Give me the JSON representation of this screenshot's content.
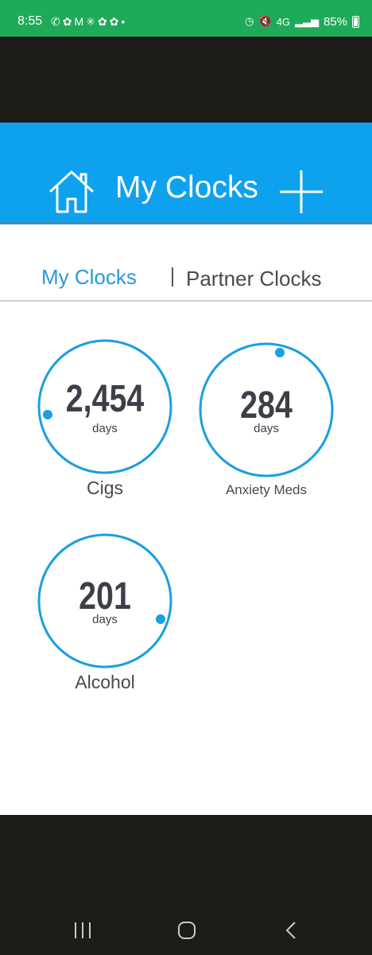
{
  "status_bar": {
    "time": "8:55",
    "left_icons": [
      "phone-icon",
      "app-icon",
      "mail-icon",
      "walmart-icon",
      "app-icon",
      "app-icon",
      "dot-icon"
    ],
    "network": "4G",
    "battery_percent": "85%",
    "background": "#1faa59"
  },
  "header": {
    "title": "My Clocks",
    "background": "#0ea1ee",
    "home_icon": "home-icon",
    "add_icon": "plus-icon"
  },
  "tabs": {
    "mine": "My Clocks",
    "partner": "Partner Clocks",
    "active_color": "#2a9ad9"
  },
  "clocks": [
    {
      "count": "2,454",
      "unit": "days",
      "name": "Cigs"
    },
    {
      "count": "284",
      "unit": "days",
      "name": "Anxiety Meds"
    },
    {
      "count": "201",
      "unit": "days",
      "name": "Alcohol"
    }
  ],
  "ring_color": "#1a9fe0",
  "nav": {
    "recents_icon": "recents-icon",
    "home_icon": "home-circle-icon",
    "back_icon": "back-chevron-icon"
  }
}
